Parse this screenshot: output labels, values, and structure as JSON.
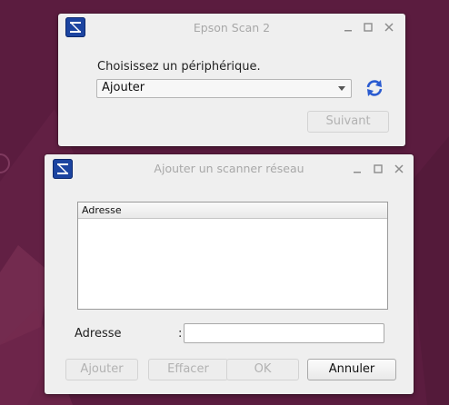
{
  "colors": {
    "accent": "#1c44a0",
    "background": "#5b1c3f",
    "window": "#efefef"
  },
  "window1": {
    "title": "Epson Scan 2",
    "controls": [
      "minimize-icon",
      "maximize-icon",
      "close-icon"
    ],
    "choose_label": "Choisissez un périphérique.",
    "device_select_value": "Ajouter",
    "next_button": "Suivant"
  },
  "window2": {
    "title": "Ajouter un scanner réseau",
    "table_header": "Adresse",
    "address_label": "Adresse",
    "colon": ":",
    "address_value": "",
    "buttons": {
      "add": "Ajouter",
      "clear": "Effacer",
      "ok": "OK",
      "cancel": "Annuler"
    }
  }
}
